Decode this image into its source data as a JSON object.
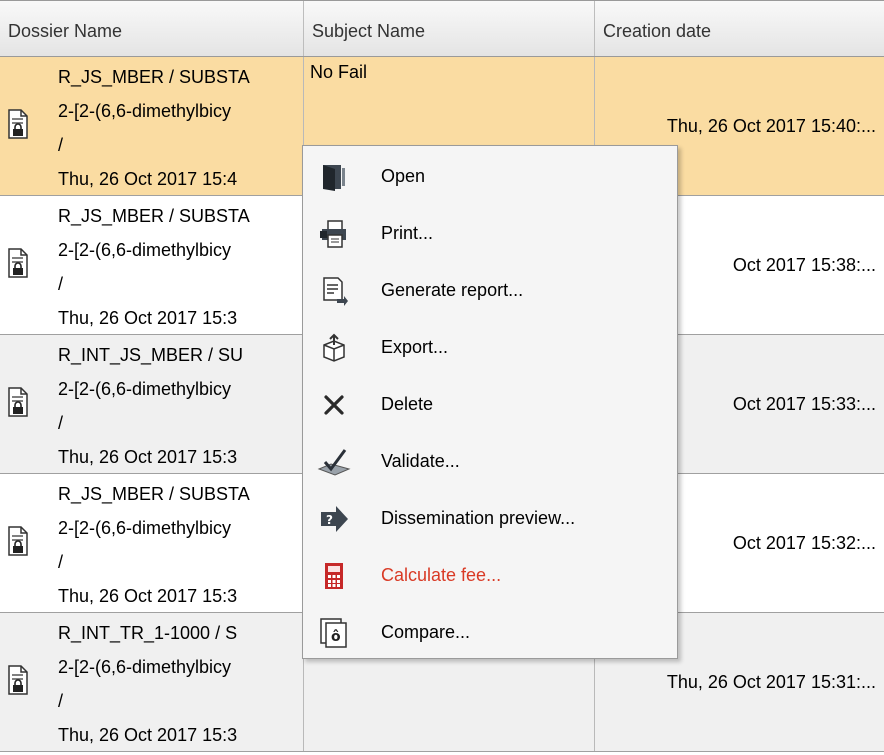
{
  "columns": {
    "dossier": "Dossier Name",
    "subject": "Subject Name",
    "date": "Creation date"
  },
  "rows": [
    {
      "dossier_lines": [
        "R_JS_MBER / SUBSTA",
        "2-[2-(6,6-dimethylbicy",
        "/",
        "Thu, 26 Oct 2017 15:4"
      ],
      "subject": "No Fail",
      "date": "Thu, 26 Oct 2017 15:40:..."
    },
    {
      "dossier_lines": [
        "R_JS_MBER / SUBSTA",
        "2-[2-(6,6-dimethylbicy",
        "/",
        "Thu, 26 Oct 2017 15:3"
      ],
      "subject": "",
      "date": "Oct 2017 15:38:..."
    },
    {
      "dossier_lines": [
        "R_INT_JS_MBER / SU",
        "2-[2-(6,6-dimethylbicy",
        "/",
        "Thu, 26 Oct 2017 15:3"
      ],
      "subject": "",
      "date": "Oct 2017 15:33:..."
    },
    {
      "dossier_lines": [
        "R_JS_MBER / SUBSTA",
        "2-[2-(6,6-dimethylbicy",
        "/",
        "Thu, 26 Oct 2017 15:3"
      ],
      "subject": "",
      "date": "Oct 2017 15:32:..."
    },
    {
      "dossier_lines": [
        "R_INT_TR_1-1000 / S",
        "2-[2-(6,6-dimethylbicy",
        "/",
        "Thu, 26 Oct 2017 15:3"
      ],
      "subject": "",
      "date": "Thu, 26 Oct 2017 15:31:..."
    }
  ],
  "context_menu": {
    "items": [
      {
        "label": "Open",
        "icon": "open-icon"
      },
      {
        "label": "Print...",
        "icon": "printer-icon"
      },
      {
        "label": "Generate report...",
        "icon": "report-icon"
      },
      {
        "label": "Export...",
        "icon": "export-icon"
      },
      {
        "label": "Delete",
        "icon": "delete-icon"
      },
      {
        "label": "Validate...",
        "icon": "validate-icon"
      },
      {
        "label": "Dissemination preview...",
        "icon": "dissemination-icon"
      },
      {
        "label": "Calculate fee...",
        "icon": "calculator-icon"
      },
      {
        "label": "Compare...",
        "icon": "compare-icon"
      }
    ]
  },
  "colors": {
    "selected_row": "#fadca2",
    "alternate_row": "#f0f0f0",
    "calculate_fee_text": "#d93a25"
  }
}
